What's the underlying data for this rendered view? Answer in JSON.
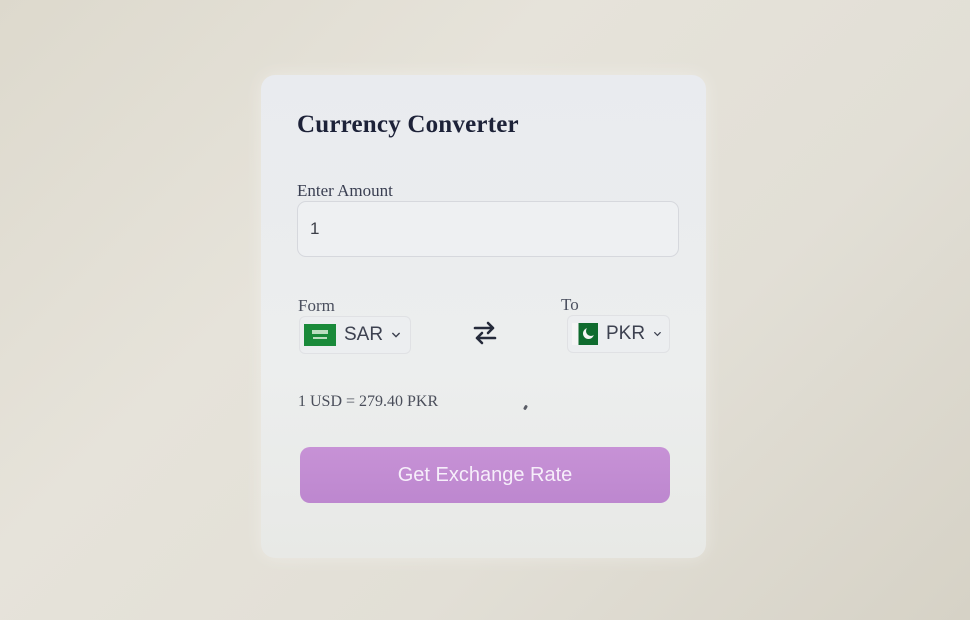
{
  "converter": {
    "title": "Currency Converter",
    "amount_label": "Enter Amount",
    "amount_value": "1",
    "from_label": "Form",
    "to_label": "To",
    "from_currency": "SAR",
    "to_currency": "PKR",
    "exchange_rate_text": "1 USD = 279.40 PKR",
    "submit_label": "Get Exchange Rate"
  },
  "icons": {
    "swap": "swap-arrows-icon",
    "from_flag": "saudi-arabia-flag-icon",
    "to_flag": "pakistan-flag-icon",
    "chevron": "chevron-down-icon"
  },
  "colors": {
    "button": "#bf8ad1",
    "title": "#1d2238",
    "card": "#eceeee"
  }
}
